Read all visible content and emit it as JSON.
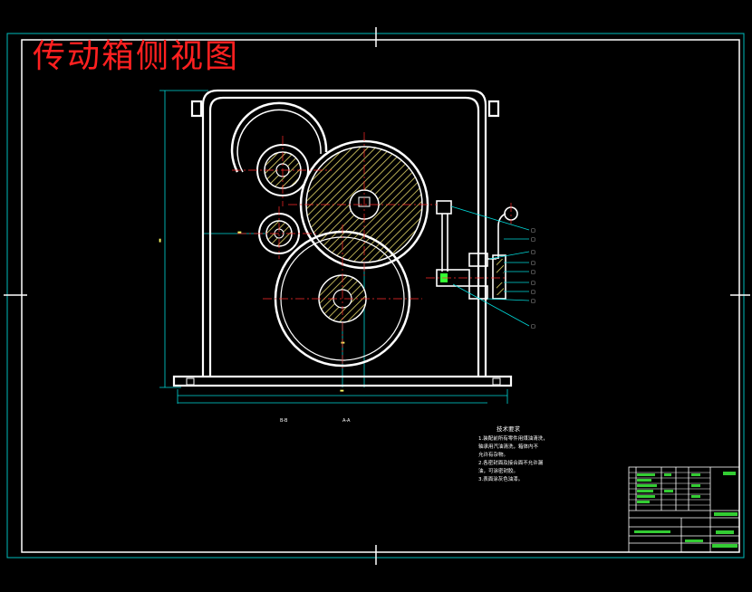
{
  "title": "传动箱侧视图",
  "notes": {
    "heading": "技术要求",
    "lines": [
      "1.装配前所有零件用煤油清洗，",
      "  轴承用汽油清洗，箱体内不",
      "  允许有杂物。",
      "2.各密封面及接合面不允许漏",
      "  油，可涂密封胶。",
      "3.表面涂灰色油漆。"
    ]
  },
  "section_marks": [
    "B-B",
    "A-A"
  ],
  "colors": {
    "background": "#000000",
    "outline": "#ffffff",
    "center_line": "#ff2a2a",
    "title_red": "#ff2020",
    "dimension": "#00e5e5",
    "hatch": "#ffff66",
    "leader": "#00e5e5",
    "table_green": "#33ff33"
  }
}
